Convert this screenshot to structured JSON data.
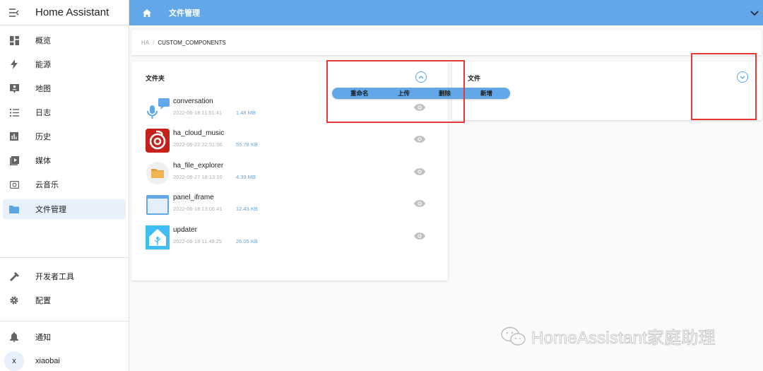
{
  "app": {
    "title": "Home Assistant"
  },
  "sidebar": {
    "items": [
      {
        "label": "概览",
        "icon": "dashboard-icon"
      },
      {
        "label": "能源",
        "icon": "lightning-icon"
      },
      {
        "label": "地图",
        "icon": "map-person-icon"
      },
      {
        "label": "日志",
        "icon": "list-icon"
      },
      {
        "label": "历史",
        "icon": "bar-chart-icon"
      },
      {
        "label": "媒体",
        "icon": "media-play-icon"
      },
      {
        "label": "云音乐",
        "icon": "music-icon"
      },
      {
        "label": "文件管理",
        "icon": "folder-icon",
        "active": true
      }
    ],
    "developer_tools": "开发者工具",
    "settings": "配置",
    "notifications": "通知",
    "user": {
      "initial": "x",
      "name": "xiaobai"
    }
  },
  "topbar": {
    "title": "文件管理"
  },
  "breadcrumb": {
    "root": "HA",
    "separator": "/",
    "current": "CUSTOM_COMPONENTS"
  },
  "folders": {
    "title": "文件夹",
    "rows": [
      {
        "name": "conversation",
        "date": "2022-06-18 11:51:41",
        "size": "1.48 MB",
        "icon": "microphone-chat-icon"
      },
      {
        "name": "ha_cloud_music",
        "date": "2022-06-22 22:51:56",
        "size": "55.78 KB",
        "icon": "netease-music-icon"
      },
      {
        "name": "ha_file_explorer",
        "date": "2022-06-27 18:13:10",
        "size": "4.39 MB",
        "icon": "folder-icon"
      },
      {
        "name": "panel_iframe",
        "date": "2022-06-18 13:06:41",
        "size": "12.43 KB",
        "icon": "window-icon"
      },
      {
        "name": "updater",
        "date": "2022-06-18 11:48:25",
        "size": "26.05 KB",
        "icon": "home-assistant-icon"
      }
    ]
  },
  "context_menu": {
    "items": [
      "重命名",
      "上传",
      "删除",
      "新增"
    ]
  },
  "files": {
    "title": "文件"
  },
  "watermark": {
    "text": "HomeAssistant家庭助理"
  },
  "colors": {
    "accent": "#62a8e8",
    "highlight": "#e53935",
    "active_bg": "#e8f0fb"
  }
}
